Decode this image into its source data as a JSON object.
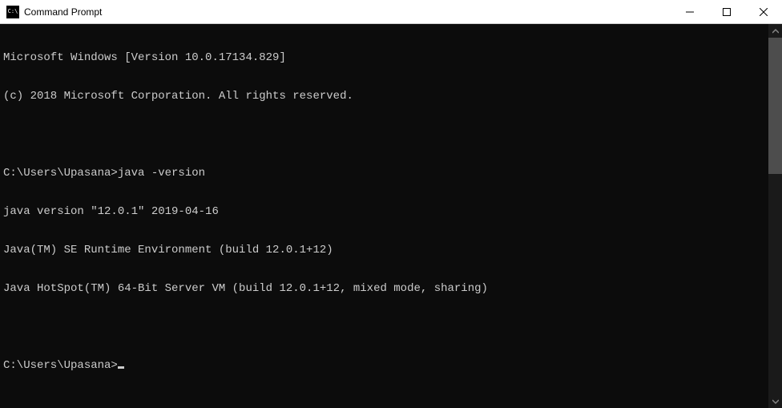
{
  "window": {
    "title": "Command Prompt"
  },
  "terminal": {
    "lines": [
      "Microsoft Windows [Version 10.0.17134.829]",
      "(c) 2018 Microsoft Corporation. All rights reserved.",
      "",
      "C:\\Users\\Upasana>java -version",
      "java version \"12.0.1\" 2019-04-16",
      "Java(TM) SE Runtime Environment (build 12.0.1+12)",
      "Java HotSpot(TM) 64-Bit Server VM (build 12.0.1+12, mixed mode, sharing)",
      "",
      "C:\\Users\\Upasana>"
    ],
    "prompt_path": "C:\\Users\\Upasana",
    "last_command": "java -version"
  }
}
